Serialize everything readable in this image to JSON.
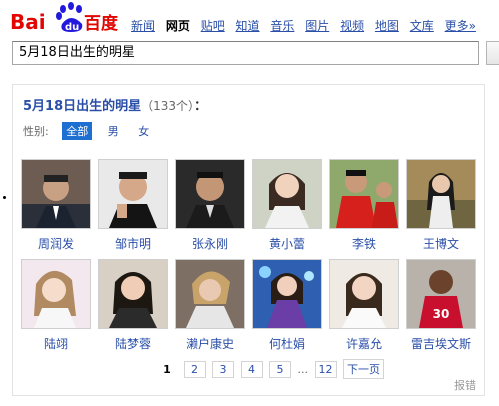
{
  "logo": {
    "left": "Bai",
    "mid": "du",
    "right": "百度"
  },
  "nav": [
    "新闻",
    "网页",
    "贴吧",
    "知道",
    "音乐",
    "图片",
    "视频",
    "地图",
    "文库",
    "更多»"
  ],
  "nav_current": "网页",
  "search": {
    "value": "5月18日出生的明星"
  },
  "panel": {
    "title": "5月18日出生的明星",
    "count": "（133个）",
    "colon": "：",
    "filter_label": "性别:",
    "filters": [
      "全部",
      "男",
      "女"
    ],
    "people": [
      "周润发",
      "邹市明",
      "张永刚",
      "黄小蕾",
      "李铁",
      "王博文",
      "陆翊",
      "陆梦蓉",
      "濑户康史",
      "何杜娟",
      "许嘉允",
      "雷吉埃文斯"
    ],
    "pager": [
      "1",
      "2",
      "3",
      "4",
      "5",
      "...",
      "12",
      "下一页"
    ],
    "report": "报错"
  },
  "colors": {
    "link": "#2a4fa8",
    "active_chip": "#1e6fd2",
    "logo_red": "#e10601",
    "logo_blue": "#2319dc"
  }
}
